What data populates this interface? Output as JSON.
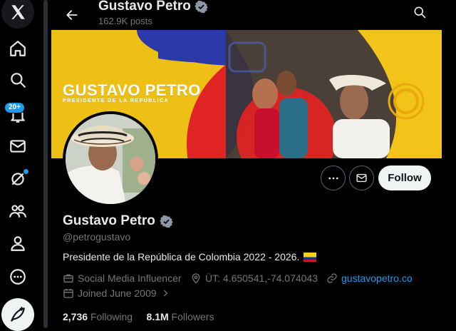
{
  "nav": {
    "icons": [
      "x-logo-icon",
      "home-icon",
      "explore-icon",
      "notifications-icon",
      "messages-icon",
      "grok-icon",
      "communities-icon",
      "profile-icon",
      "more-icon",
      "compose-icon"
    ],
    "notifications_badge": "20+"
  },
  "header": {
    "title": "Gustavo Petro",
    "posts_count": "162.9K posts"
  },
  "banner": {
    "name": "GUSTAVO PETRO",
    "subtitle": "PRESIDENTE DE LA REPÚBLICA"
  },
  "actions": {
    "follow_label": "Follow"
  },
  "profile": {
    "name": "Gustavo Petro",
    "handle": "@petrogustavo",
    "bio": "Presidente de la República de Colombia 2022 - 2026.",
    "category": "Social Media Influencer",
    "location": "ÜT: 4.650541,-74.074043",
    "website": "gustavopetro.co",
    "joined": "Joined June 2009",
    "following_count": "2,736",
    "following_label": "Following",
    "followers_count": "8.1M",
    "followers_label": "Followers"
  },
  "colors": {
    "accent": "#1d9bf0",
    "background": "#000000",
    "banner_yellow": "#f2c318",
    "banner_blue": "#2b3aa8",
    "banner_red": "#e02323"
  }
}
